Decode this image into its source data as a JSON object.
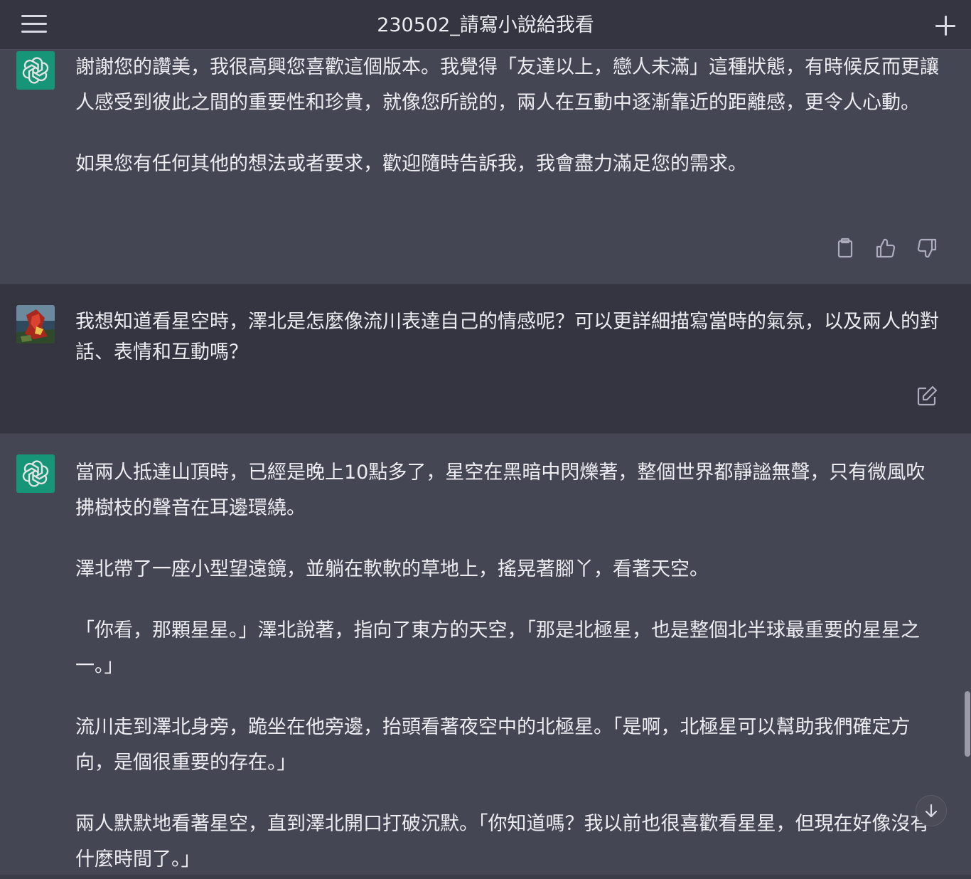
{
  "header": {
    "title": "230502_請寫小說給我看",
    "menu_icon": "hamburger-menu-icon",
    "new_chat_icon": "plus-icon"
  },
  "messages": [
    {
      "role": "assistant",
      "avatar_icon": "openai-logo-icon",
      "paragraphs": [
        "謝謝您的讚美，我很高興您喜歡這個版本。我覺得「友達以上，戀人未滿」這種狀態，有時候反而更讓人感受到彼此之間的重要性和珍貴，就像您所說的，兩人在互動中逐漸靠近的距離感，更令人心動。",
        "如果您有任何其他的想法或者要求，歡迎隨時告訴我，我會盡力滿足您的需求。"
      ],
      "actions": [
        "copy-icon",
        "thumbs-up-icon",
        "thumbs-down-icon"
      ]
    },
    {
      "role": "user",
      "avatar_icon": "user-avatar-image",
      "paragraphs": [
        "我想知道看星空時，澤北是怎麼像流川表達自己的情感呢？可以更詳細描寫當時的氣氛，以及兩人的對話、表情和互動嗎？"
      ],
      "actions": [
        "edit-icon"
      ]
    },
    {
      "role": "assistant",
      "avatar_icon": "openai-logo-icon",
      "paragraphs": [
        "當兩人抵達山頂時，已經是晚上10點多了，星空在黑暗中閃爍著，整個世界都靜謐無聲，只有微風吹拂樹枝的聲音在耳邊環繞。",
        "澤北帶了一座小型望遠鏡，並躺在軟軟的草地上，搖晃著腳丫，看著天空。",
        "「你看，那顆星星。」澤北說著，指向了東方的天空，「那是北極星，也是整個北半球最重要的星星之一。」",
        "流川走到澤北身旁，跪坐在他旁邊，抬頭看著夜空中的北極星。「是啊，北極星可以幫助我們確定方向，是個很重要的存在。」",
        "兩人默默地看著星空，直到澤北開口打破沉默。「你知道嗎？我以前也很喜歡看星星，但現在好像沒有什麼時間了。」"
      ]
    }
  ],
  "scroll_down_icon": "arrow-down-icon",
  "colors": {
    "assistant_bg": "#444654",
    "user_bg": "#343541",
    "accent": "#10a37f",
    "text": "#ececf1"
  }
}
